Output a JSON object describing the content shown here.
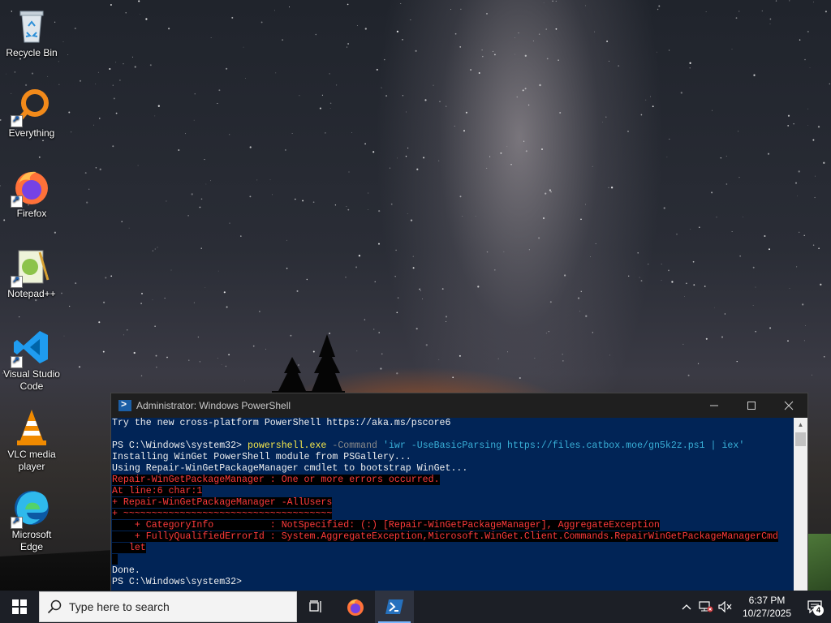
{
  "desktop": {
    "icons": [
      {
        "label": "Recycle Bin"
      },
      {
        "label": "Everything"
      },
      {
        "label": "Firefox"
      },
      {
        "label": "Notepad++"
      },
      {
        "label": "Visual Studio Code"
      },
      {
        "label": "VLC media player"
      },
      {
        "label": "Microsoft Edge"
      }
    ]
  },
  "powershell": {
    "title": "Administrator: Windows PowerShell",
    "lines": {
      "l1": "Try the new cross-platform PowerShell https://aka.ms/pscore6",
      "prompt": "PS C:\\Windows\\system32> ",
      "cmd_exe": "powershell.exe",
      "cmd_param": "-Command",
      "cmd_str": "'iwr -UseBasicParsing https://files.catbox.moe/gn5k2z.ps1 | iex'",
      "l3": "Installing WinGet PowerShell module from PSGallery...",
      "l4": "Using Repair-WinGetPackageManager cmdlet to bootstrap WinGet...",
      "e1": "Repair-WinGetPackageManager : One or more errors occurred.",
      "e2": "At line:6 char:1",
      "e3": "+ Repair-WinGetPackageManager -AllUsers",
      "e4": "+ ~~~~~~~~~~~~~~~~~~~~~~~~~~~~~~~~~~~~~",
      "e5": "    + CategoryInfo          : NotSpecified: (:) [Repair-WinGetPackageManager], AggregateException",
      "e6": "    + FullyQualifiedErrorId : System.AggregateException,Microsoft.WinGet.Client.Commands.RepairWinGetPackageManagerCmd",
      "e7": "   let",
      "done": "Done.",
      "final_prompt": "PS C:\\Windows\\system32>"
    }
  },
  "taskbar": {
    "search_placeholder": "Type here to search",
    "time": "6:37 PM",
    "date": "10/27/2025",
    "notification_count": "4"
  }
}
